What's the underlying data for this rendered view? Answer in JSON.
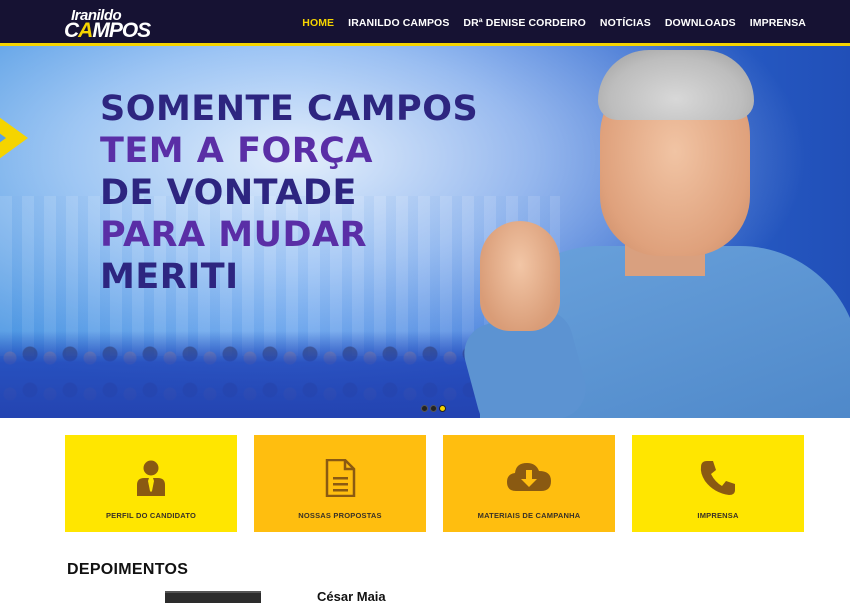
{
  "brand": {
    "logo_line1": "Iranildo",
    "logo_line2_a": "C",
    "logo_line2_b": "A",
    "logo_line2_c": "MPOS"
  },
  "nav": {
    "items": [
      "HOME",
      "IRANILDO CAMPOS",
      "DRª DENISE CORDEIRO",
      "NOTÍCIAS",
      "DOWNLOADS",
      "IMPRENSA"
    ],
    "active": "HOME"
  },
  "hero": {
    "lines": [
      "SOMENTE CAMPOS",
      "TEM A FORÇA",
      "DE VONTADE",
      "PARA MUDAR",
      "MERITI"
    ],
    "slide_count": 3,
    "active_slide": 3
  },
  "tiles": [
    {
      "label": "PERFIL DO CANDIDATO",
      "icon": "candidate-profile-icon",
      "color": "#ffe600"
    },
    {
      "label": "NOSSAS PROPOSTAS",
      "icon": "document-icon",
      "color": "#ffbe0f"
    },
    {
      "label": "MATERIAIS DE CAMPANHA",
      "icon": "cloud-download-icon",
      "color": "#ffbe0f"
    },
    {
      "label": "IMPRENSA",
      "icon": "phone-icon",
      "color": "#ffe600"
    }
  ],
  "testimonials": {
    "title": "DEPOIMENTOS",
    "first_name": "César Maia"
  },
  "colors": {
    "header_bg": "#161233",
    "accent": "#f5d400",
    "headline_dark": "#2d2580",
    "headline_purple": "#5a2ea6"
  }
}
